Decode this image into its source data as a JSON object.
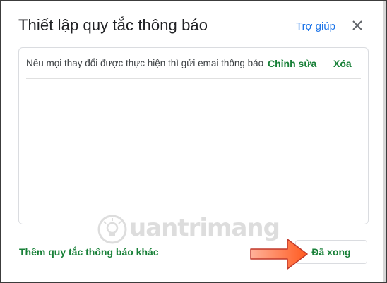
{
  "dialog": {
    "title": "Thiết lập quy tắc thông báo",
    "help_label": "Trợ giúp",
    "close_icon": "close-icon"
  },
  "rules": [
    {
      "text": "Nếu mọi thay đổi được thực hiện thì gửi emai thông báo",
      "edit_label": "Chỉnh sửa",
      "delete_label": "Xóa"
    }
  ],
  "footer": {
    "add_rule_label": "Thêm quy tắc thông báo khác",
    "done_label": "Đã xong"
  },
  "watermark": {
    "text": "uantrimang",
    "icon": "lightbulb-icon"
  },
  "colors": {
    "green_action": "#188038",
    "blue_link": "#1a73e8",
    "arrow_fill": "#ff6a2b"
  }
}
